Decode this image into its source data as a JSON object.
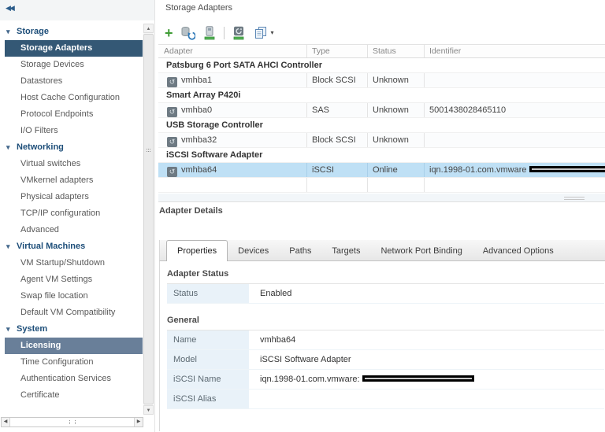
{
  "icons": {
    "collapse": "◀◀",
    "section_arrow": "▾",
    "plus": "+",
    "caret": "▾",
    "adapter_glyph": "↺",
    "up": "▲",
    "down": "▼",
    "left": "◀",
    "right": "▶"
  },
  "colors": {
    "sidebar_selected": "#345875",
    "sidebar_selected_inactive": "#697f99",
    "section_text": "#1d4e79",
    "row_selected": "#bfe0f5",
    "toolbar_green": "#3f9c35",
    "label_cell_bg": "#e9f2f9"
  },
  "sidebar": {
    "items": [
      {
        "label": "Storage",
        "type": "section"
      },
      {
        "label": "Storage Adapters",
        "type": "item",
        "state": "selected"
      },
      {
        "label": "Storage Devices",
        "type": "item"
      },
      {
        "label": "Datastores",
        "type": "item"
      },
      {
        "label": "Host Cache Configuration",
        "type": "item"
      },
      {
        "label": "Protocol Endpoints",
        "type": "item"
      },
      {
        "label": "I/O Filters",
        "type": "item"
      },
      {
        "label": "Networking",
        "type": "section"
      },
      {
        "label": "Virtual switches",
        "type": "item"
      },
      {
        "label": "VMkernel adapters",
        "type": "item"
      },
      {
        "label": "Physical adapters",
        "type": "item"
      },
      {
        "label": "TCP/IP configuration",
        "type": "item"
      },
      {
        "label": "Advanced",
        "type": "item"
      },
      {
        "label": "Virtual Machines",
        "type": "section"
      },
      {
        "label": "VM Startup/Shutdown",
        "type": "item"
      },
      {
        "label": "Agent VM Settings",
        "type": "item"
      },
      {
        "label": "Swap file location",
        "type": "item"
      },
      {
        "label": "Default VM Compatibility",
        "type": "item"
      },
      {
        "label": "System",
        "type": "section"
      },
      {
        "label": "Licensing",
        "type": "item",
        "state": "selected-inactive"
      },
      {
        "label": "Time Configuration",
        "type": "item"
      },
      {
        "label": "Authentication Services",
        "type": "item"
      },
      {
        "label": "Certificate",
        "type": "item"
      }
    ]
  },
  "main": {
    "title": "Storage Adapters",
    "table": {
      "columns": [
        "Adapter",
        "Type",
        "Status",
        "Identifier"
      ],
      "rows": [
        {
          "kind": "group",
          "label": "Patsburg 6 Port SATA AHCI Controller"
        },
        {
          "kind": "adapter",
          "adapter": "vmhba1",
          "type": "Block SCSI",
          "status": "Unknown",
          "identifier": ""
        },
        {
          "kind": "group",
          "label": "Smart Array P420i"
        },
        {
          "kind": "adapter",
          "adapter": "vmhba0",
          "type": "SAS",
          "status": "Unknown",
          "identifier": "5001438028465110"
        },
        {
          "kind": "group",
          "label": "USB Storage Controller"
        },
        {
          "kind": "adapter",
          "adapter": "vmhba32",
          "type": "Block SCSI",
          "status": "Unknown",
          "identifier": ""
        },
        {
          "kind": "group",
          "label": "iSCSI Software Adapter"
        },
        {
          "kind": "adapter",
          "adapter": "vmhba64",
          "type": "iSCSI",
          "status": "Online",
          "identifier": "iqn.1998-01.com.vmware",
          "redacted": true,
          "selected": true
        }
      ]
    },
    "details": {
      "title": "Adapter Details",
      "tabs": [
        {
          "label": "Properties",
          "active": true
        },
        {
          "label": "Devices"
        },
        {
          "label": "Paths"
        },
        {
          "label": "Targets"
        },
        {
          "label": "Network Port Binding"
        },
        {
          "label": "Advanced Options"
        }
      ],
      "sections": [
        {
          "heading": "Adapter Status",
          "rows": [
            {
              "label": "Status",
              "value": "Enabled"
            }
          ]
        },
        {
          "heading": "General",
          "rows": [
            {
              "label": "Name",
              "value": "vmhba64"
            },
            {
              "label": "Model",
              "value": "iSCSI Software Adapter"
            },
            {
              "label": "iSCSI Name",
              "value": "iqn.1998-01.com.vmware:",
              "redacted": true
            },
            {
              "label": "iSCSI Alias",
              "value": ""
            }
          ]
        }
      ]
    }
  }
}
